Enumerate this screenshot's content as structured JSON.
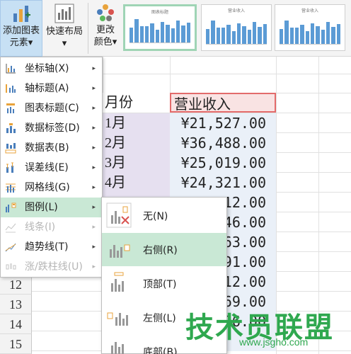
{
  "ribbon": {
    "add_chart_element": {
      "line1": "添加图表",
      "line2": "元素",
      "arrow": "▾"
    },
    "quick_layout": {
      "label": "快速布局",
      "arrow": "▾"
    },
    "change_colors": {
      "line1": "更改",
      "line2": "颜色",
      "arrow": "▾"
    },
    "gallery_thumbs": [
      {
        "title": "图表标题",
        "selected": true
      },
      {
        "title": "营业收入",
        "selected": false
      },
      {
        "title": "营业收入",
        "selected": false
      }
    ]
  },
  "sheet": {
    "header": {
      "col_a": "月份",
      "col_b": "营业收入"
    },
    "rows": [
      {
        "month": "1月",
        "revenue": "¥21,527.00"
      },
      {
        "month": "2月",
        "revenue": "¥36,488.00"
      },
      {
        "month": "3月",
        "revenue": "¥25,019.00"
      },
      {
        "month": "4月",
        "revenue": "¥24,321.00"
      },
      {
        "month": "",
        "revenue": "12.00"
      },
      {
        "month": "",
        "revenue": "46.00"
      },
      {
        "month": "",
        "revenue": "63.00"
      },
      {
        "month": "",
        "revenue": "91.00"
      },
      {
        "month": "",
        "revenue": "12.00"
      },
      {
        "month": "",
        "revenue": "69.00"
      },
      {
        "month": "",
        "revenue": "96.00"
      }
    ],
    "row_numbers": [
      "12",
      "13",
      "14",
      "15"
    ]
  },
  "menu": {
    "items": [
      {
        "label": "坐标轴(X)",
        "icon": "axis-icon"
      },
      {
        "label": "轴标题(A)",
        "icon": "axis-title-icon"
      },
      {
        "label": "图表标题(C)",
        "icon": "chart-title-icon"
      },
      {
        "label": "数据标签(D)",
        "icon": "data-label-icon"
      },
      {
        "label": "数据表(B)",
        "icon": "data-table-icon"
      },
      {
        "label": "误差线(E)",
        "icon": "error-bar-icon"
      },
      {
        "label": "网格线(G)",
        "icon": "gridline-icon"
      },
      {
        "label": "图例(L)",
        "icon": "legend-icon"
      },
      {
        "label": "线条(I)",
        "icon": "lines-icon"
      },
      {
        "label": "趋势线(T)",
        "icon": "trendline-icon"
      },
      {
        "label": "涨/跌柱线(U)",
        "icon": "up-down-bar-icon"
      }
    ],
    "arrow": "▸"
  },
  "submenu": {
    "items": [
      {
        "label": "无(N)",
        "icon": "legend-none-icon"
      },
      {
        "label": "右侧(R)",
        "icon": "legend-right-icon"
      },
      {
        "label": "顶部(T)",
        "icon": "legend-top-icon"
      },
      {
        "label": "左侧(L)",
        "icon": "legend-left-icon"
      },
      {
        "label": "底部(B)",
        "icon": "legend-bottom-icon"
      }
    ]
  },
  "watermark": {
    "text": "技术员联盟",
    "url": "www.jsgho.com"
  },
  "colors": {
    "accent_green": "#c9e8d5",
    "ribbon_active": "#c7e0f4",
    "header_red": "#e36b6b",
    "bar_blue": "#5b9bd5"
  }
}
